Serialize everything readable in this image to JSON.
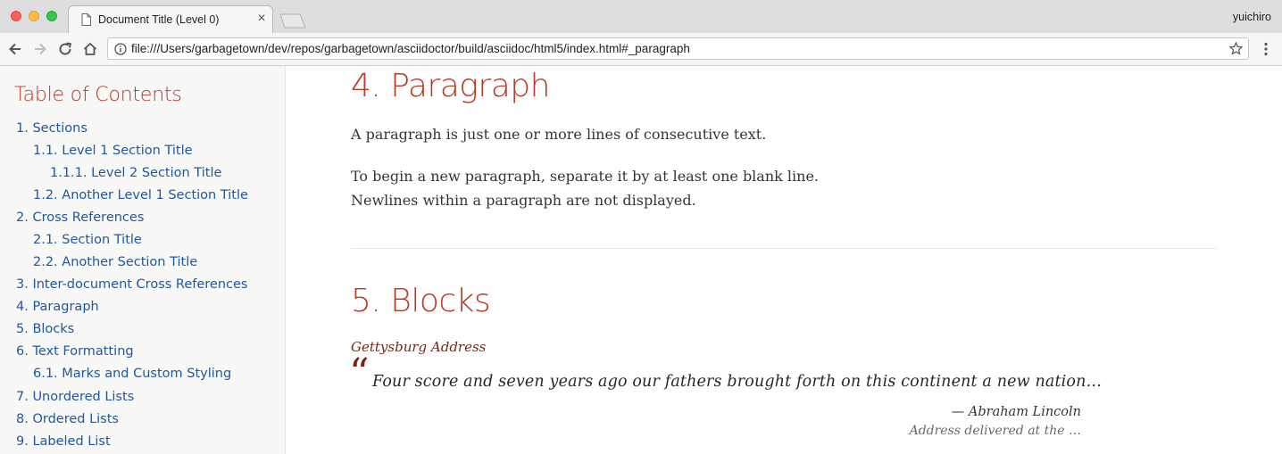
{
  "browser": {
    "tab_title": "Document Title (Level 0)",
    "tab_close": "×",
    "profile": "yuichiro",
    "url": "file:///Users/garbagetown/dev/repos/garbagetown/asciidoctor/build/asciidoc/html5/index.html#_paragraph",
    "icons": [
      "back-icon",
      "forward-icon",
      "reload-icon",
      "home-icon",
      "info-icon",
      "star-icon",
      "menu-icon",
      "document-icon"
    ]
  },
  "toc": {
    "title": "Table of Contents",
    "items": [
      {
        "label": "1. Sections",
        "level": 0
      },
      {
        "label": "1.1. Level 1 Section Title",
        "level": 1
      },
      {
        "label": "1.1.1. Level 2 Section Title",
        "level": 2
      },
      {
        "label": "1.2. Another Level 1 Section Title",
        "level": 1
      },
      {
        "label": "2. Cross References",
        "level": 0
      },
      {
        "label": "2.1. Section Title",
        "level": 1
      },
      {
        "label": "2.2. Another Section Title",
        "level": 1
      },
      {
        "label": "3. Inter-document Cross References",
        "level": 0
      },
      {
        "label": "4. Paragraph",
        "level": 0
      },
      {
        "label": "5. Blocks",
        "level": 0
      },
      {
        "label": "6. Text Formatting",
        "level": 0
      },
      {
        "label": "6.1. Marks and Custom Styling",
        "level": 1
      },
      {
        "label": "7. Unordered Lists",
        "level": 0
      },
      {
        "label": "8. Ordered Lists",
        "level": 0
      },
      {
        "label": "9. Labeled List",
        "level": 0
      }
    ]
  },
  "content": {
    "section4": {
      "title": "4. Paragraph",
      "p1": "A paragraph is just one or more lines of consecutive text.",
      "p2_line1": "To begin a new paragraph, separate it by at least one blank line.",
      "p2_line2": "Newlines within a paragraph are not displayed."
    },
    "section5": {
      "title": "5. Blocks",
      "quote_title": "Gettysburg Address",
      "quote_mark": "“",
      "quote_text": "Four score and seven years ago our fathers brought forth on this continent a new nation…",
      "attribution": "— Abraham Lincoln",
      "citetitle": "Address delivered at the …"
    }
  },
  "colors": {
    "heading": "#ba3925",
    "link": "#2156a5",
    "quote_accent": "#7a2518",
    "toc_background": "#f8f8f7"
  }
}
